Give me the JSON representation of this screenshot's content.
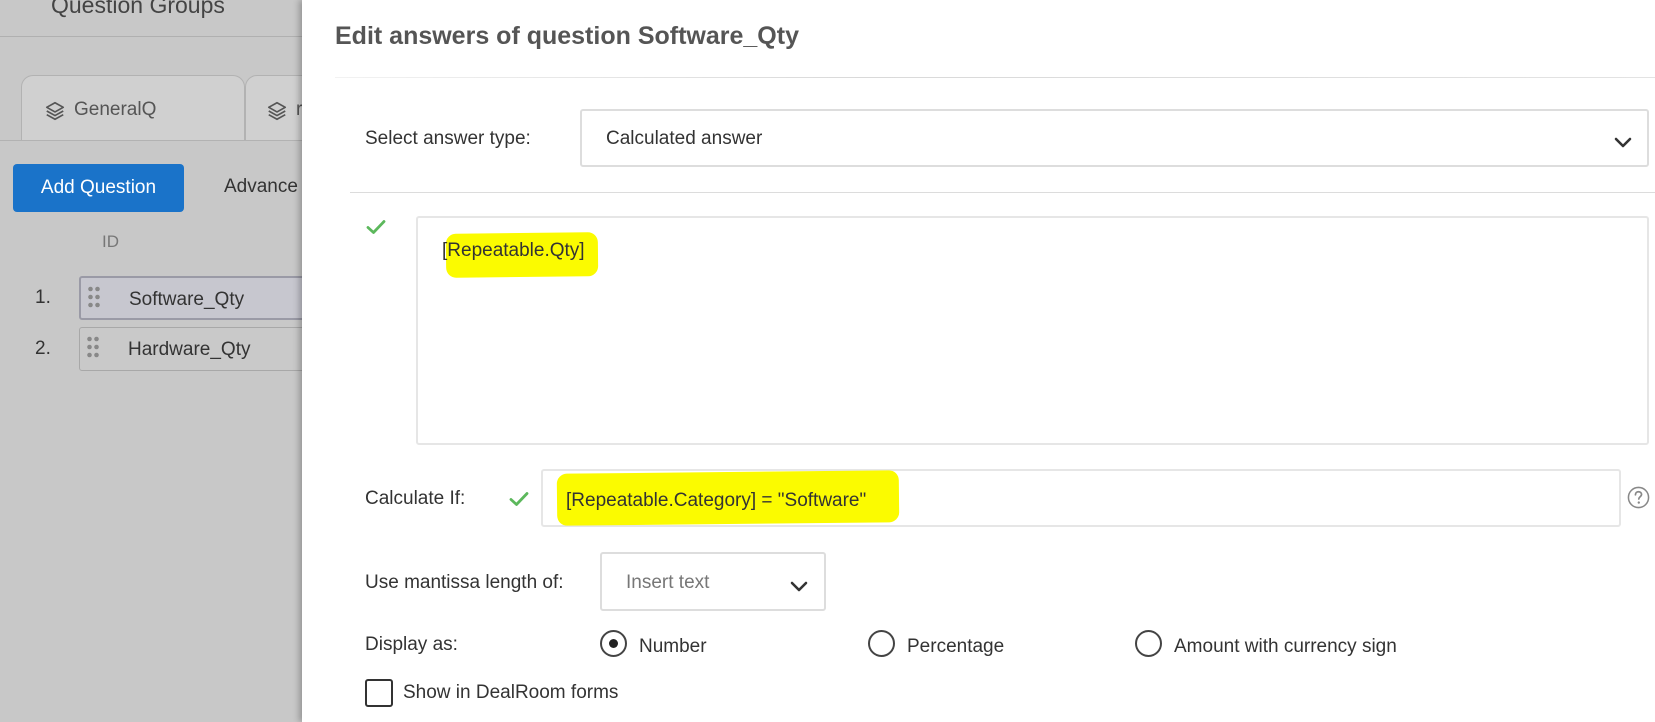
{
  "sidebar": {
    "title": "Question Groups",
    "tabs": [
      {
        "label": "GeneralQ",
        "icon": "layers-icon"
      },
      {
        "label": "r",
        "icon": "layers-icon"
      }
    ],
    "add_question_label": "Add Question",
    "advanced_label": "Advance",
    "id_column_header": "ID",
    "questions": [
      {
        "index": "1.",
        "label": "Software_Qty",
        "selected": true
      },
      {
        "index": "2.",
        "label": "Hardware_Qty",
        "selected": false
      }
    ]
  },
  "modal": {
    "title": "Edit answers of question Software_Qty",
    "answer_type": {
      "label": "Select answer type:",
      "value": "Calculated answer"
    },
    "formula": {
      "value": "[Repeatable.Qty]",
      "valid": true
    },
    "calculate_if": {
      "label": "Calculate If:",
      "value": "[Repeatable.Category] = \"Software\"",
      "valid": true
    },
    "mantissa": {
      "label": "Use mantissa length of:",
      "placeholder": "Insert text"
    },
    "display_as": {
      "label": "Display as:",
      "options": [
        {
          "label": "Number",
          "checked": true
        },
        {
          "label": "Percentage",
          "checked": false
        },
        {
          "label": "Amount with currency sign",
          "checked": false
        }
      ]
    },
    "show_in_dealroom": {
      "label": "Show in DealRoom forms",
      "checked": false
    }
  },
  "colors": {
    "primary_button": "#1a73c9",
    "valid_check": "#5cb85c",
    "highlight": "#fbfb00",
    "overlay_background": "#c8c8c8"
  }
}
